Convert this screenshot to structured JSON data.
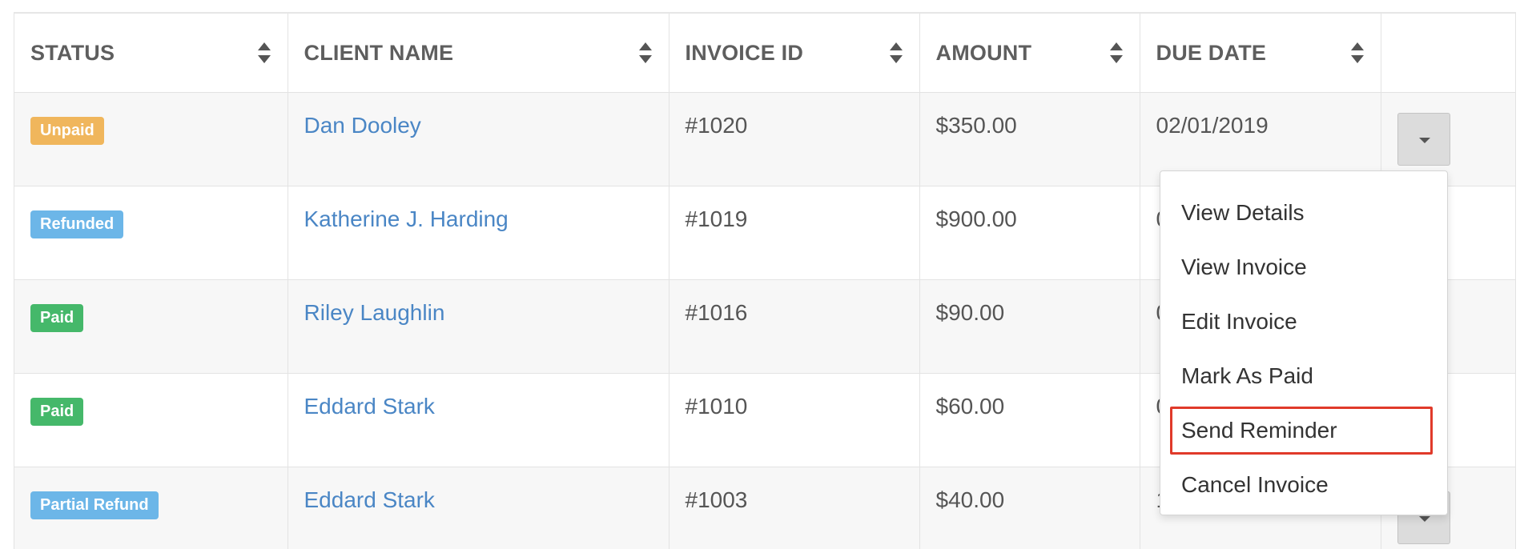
{
  "table": {
    "columns": [
      {
        "label": "STATUS",
        "sortable": true
      },
      {
        "label": "CLIENT NAME",
        "sortable": true
      },
      {
        "label": "INVOICE ID",
        "sortable": true
      },
      {
        "label": "AMOUNT",
        "sortable": true
      },
      {
        "label": "DUE DATE",
        "sortable": true
      },
      {
        "label": "",
        "sortable": false
      }
    ],
    "rows": [
      {
        "status": "Unpaid",
        "status_color": "#f0b65c",
        "client": "Dan Dooley",
        "invoice": "#1020",
        "amount": "$350.00",
        "due": "02/01/2019"
      },
      {
        "status": "Refunded",
        "status_color": "#6cb6e8",
        "client": "Katherine J. Harding",
        "invoice": "#1019",
        "amount": "$900.00",
        "due": "0"
      },
      {
        "status": "Paid",
        "status_color": "#45b86a",
        "client": "Riley Laughlin",
        "invoice": "#1016",
        "amount": "$90.00",
        "due": "0"
      },
      {
        "status": "Paid",
        "status_color": "#45b86a",
        "client": "Eddard Stark",
        "invoice": "#1010",
        "amount": "$60.00",
        "due": "0"
      },
      {
        "status": "Partial Refund",
        "status_color": "#6cb6e8",
        "client": "Eddard Stark",
        "invoice": "#1003",
        "amount": "$40.00",
        "due": "1"
      }
    ]
  },
  "dropdown_menu": {
    "items": [
      "View Details",
      "View Invoice",
      "Edit Invoice",
      "Mark As Paid",
      "Send Reminder",
      "Cancel Invoice"
    ],
    "highlighted": "Send Reminder",
    "highlight_color": "#e03a2a"
  },
  "colors": {
    "link": "#4a86c5",
    "row_alt": "#f7f7f7"
  }
}
